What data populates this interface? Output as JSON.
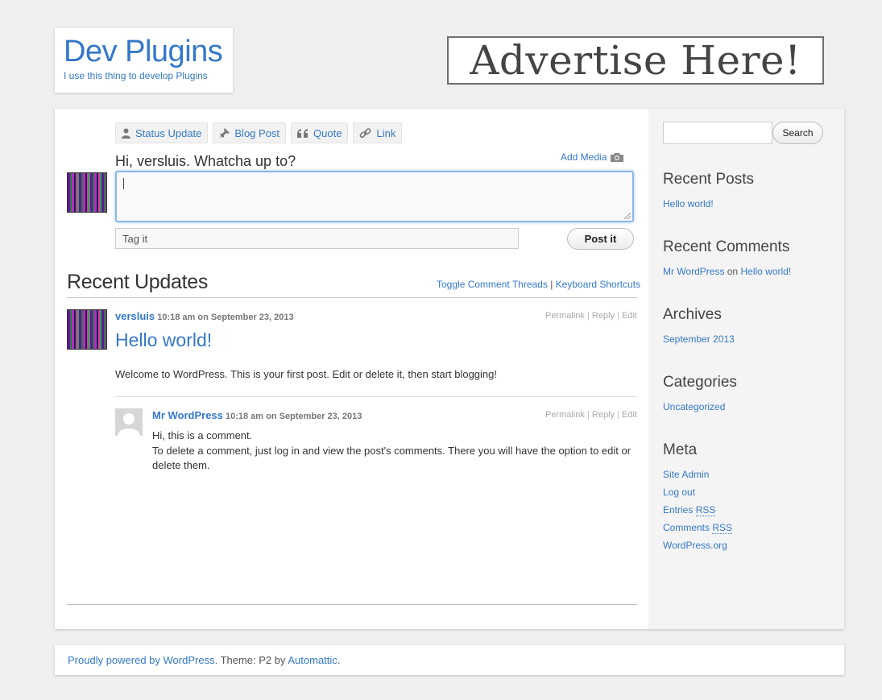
{
  "header": {
    "site_title": "Dev Plugins",
    "site_description": "I use this thing to develop Plugins"
  },
  "advert": {
    "text": "Advertise Here!"
  },
  "post_form": {
    "post_types": [
      {
        "label": "Status Update",
        "icon": "person-icon"
      },
      {
        "label": "Blog Post",
        "icon": "pin-icon"
      },
      {
        "label": "Quote",
        "icon": "quote-icon"
      },
      {
        "label": "Link",
        "icon": "link-icon"
      }
    ],
    "greeting": "Hi, versluis. Whatcha up to?",
    "add_media_label": "Add Media",
    "tag_placeholder": "Tag it",
    "post_button": "Post it"
  },
  "recent_updates": {
    "title": "Recent Updates",
    "toggle_threads": "Toggle Comment Threads",
    "separator": "|",
    "keyboard_shortcuts": "Keyboard Shortcuts"
  },
  "post": {
    "author": "versluis",
    "time": "10:18 am",
    "on": "on",
    "date": "September 23, 2013",
    "actions": {
      "permalink": "Permalink",
      "reply": "Reply",
      "edit": "Edit",
      "sep": "|"
    },
    "title": "Hello world!",
    "body": "Welcome to WordPress. This is your first post. Edit or delete it, then start blogging!"
  },
  "comment": {
    "author": "Mr WordPress",
    "time": "10:18 am",
    "on": "on",
    "date": "September 23, 2013",
    "actions": {
      "permalink": "Permalink",
      "reply": "Reply",
      "edit": "Edit",
      "sep": "|"
    },
    "line1": "Hi, this is a comment.",
    "line2": "To delete a comment, just log in and view the post's comments. There you will have the option to edit or delete them."
  },
  "sidebar": {
    "search_button": "Search",
    "recent_posts": {
      "title": "Recent Posts",
      "items": [
        "Hello world!"
      ]
    },
    "recent_comments": {
      "title": "Recent Comments",
      "author": "Mr WordPress",
      "on": "on",
      "post": "Hello world!"
    },
    "archives": {
      "title": "Archives",
      "items": [
        "September 2013"
      ]
    },
    "categories": {
      "title": "Categories",
      "items": [
        "Uncategorized"
      ]
    },
    "meta": {
      "title": "Meta",
      "site_admin": "Site Admin",
      "log_out": "Log out",
      "entries": "Entries",
      "comments": "Comments",
      "rss": "RSS",
      "wordpress_org": "WordPress.org"
    }
  },
  "footer": {
    "powered_link": "Proudly powered by WordPress.",
    "theme_text": " Theme: P2 by ",
    "theme_author": "Automattic",
    "period": "."
  }
}
